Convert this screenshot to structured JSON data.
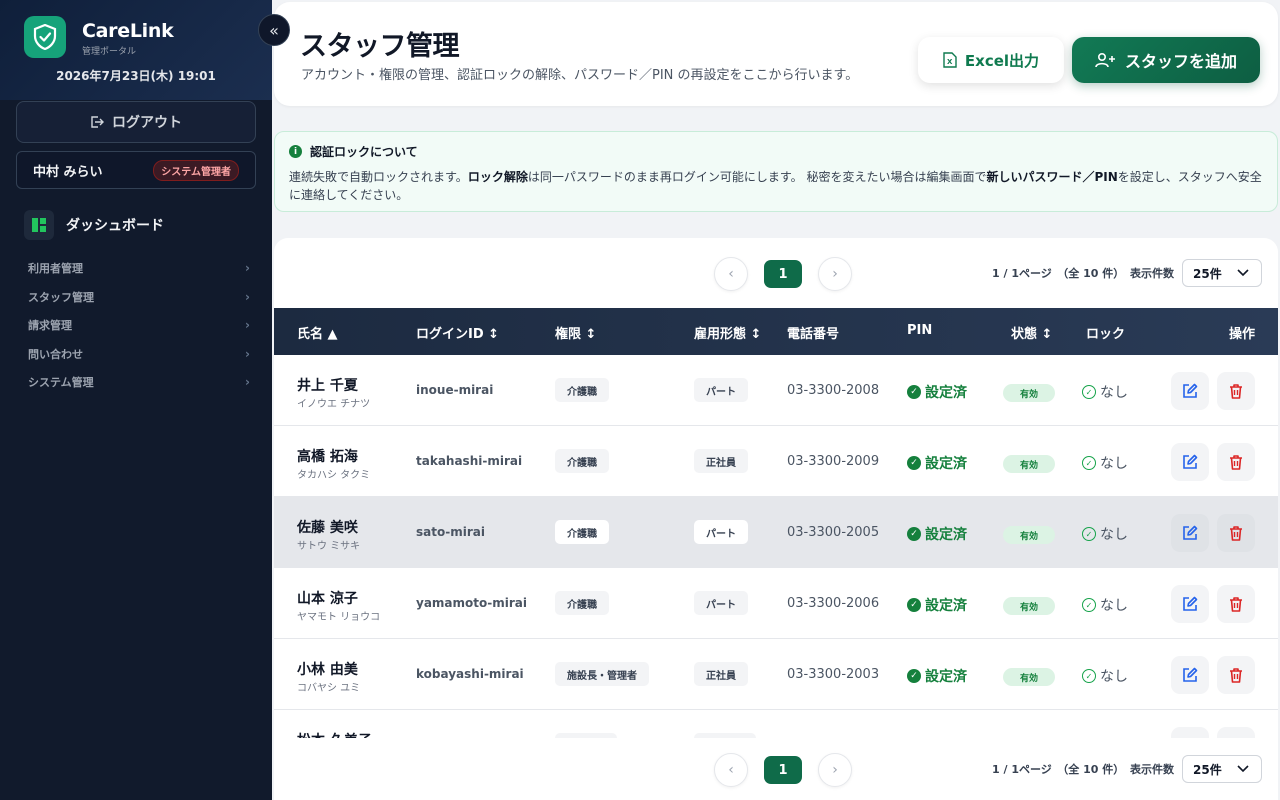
{
  "app": {
    "brand": "CareLink",
    "brand_sub": "管理ポータル",
    "datetime": "2026年7月23日(木) 19:01"
  },
  "sidebar": {
    "logout_label": "ログアウト",
    "user_name": "中村 みらい",
    "user_role": "システム管理者",
    "dashboard_label": "ダッシュボード",
    "nav_items": [
      {
        "label": "利用者管理"
      },
      {
        "label": "スタッフ管理"
      },
      {
        "label": "請求管理"
      },
      {
        "label": "問い合わせ"
      },
      {
        "label": "システム管理"
      }
    ]
  },
  "header": {
    "title": "スタッフ管理",
    "subtitle": "アカウント・権限の管理、認証ロックの解除、パスワード／PIN の再設定をここから行います。",
    "excel_label": "Excel出力",
    "add_label": "スタッフを追加"
  },
  "info": {
    "title": "認証ロックについて",
    "text1": "連続失敗で自動ロックされます。",
    "bold1": "ロック解除",
    "text2": "は同一パスワードのまま再ログイン可能にします。 秘密を変えたい場合は編集画面で",
    "bold2": "新しいパスワード／PIN",
    "text3": "を設定し、スタッフへ安全に連絡してください。"
  },
  "pager": {
    "current_page": "1",
    "page_info": "1 / 1ページ　（全 10 件）",
    "per_page_label": "表示件数",
    "per_page_value": "25件"
  },
  "table": {
    "headers": {
      "name": "氏名 ▲",
      "login_id": "ログインID ↕",
      "role": "権限 ↕",
      "employment": "雇用形態 ↕",
      "phone": "電話番号",
      "pin": "PIN",
      "status": "状態 ↕",
      "lock": "ロック",
      "actions": "操作"
    },
    "rows": [
      {
        "name": "井上 千夏",
        "kana": "イノウエ チナツ",
        "login_id": "inoue-mirai",
        "role": "介護職",
        "employment": "パート",
        "phone": "03-3300-2008",
        "pin": "設定済",
        "status": "有効",
        "lock": "なし"
      },
      {
        "name": "高橋 拓海",
        "kana": "タカハシ タクミ",
        "login_id": "takahashi-mirai",
        "role": "介護職",
        "employment": "正社員",
        "phone": "03-3300-2009",
        "pin": "設定済",
        "status": "有効",
        "lock": "なし"
      },
      {
        "name": "佐藤 美咲",
        "kana": "サトウ ミサキ",
        "login_id": "sato-mirai",
        "role": "介護職",
        "employment": "パート",
        "phone": "03-3300-2005",
        "pin": "設定済",
        "status": "有効",
        "lock": "なし"
      },
      {
        "name": "山本 涼子",
        "kana": "ヤマモト リョウコ",
        "login_id": "yamamoto-mirai",
        "role": "介護職",
        "employment": "パート",
        "phone": "03-3300-2006",
        "pin": "設定済",
        "status": "有効",
        "lock": "なし"
      },
      {
        "name": "小林 由美",
        "kana": "コバヤシ ユミ",
        "login_id": "kobayashi-mirai",
        "role": "施設長・管理者",
        "employment": "正社員",
        "phone": "03-3300-2003",
        "pin": "設定済",
        "status": "有効",
        "lock": "なし"
      },
      {
        "name": "松本 久美子",
        "kana": "",
        "login_id": "",
        "role": "",
        "employment": "",
        "phone": "",
        "pin": "",
        "status": "",
        "lock": ""
      }
    ]
  },
  "colors": {
    "sidebar_bg": "#111a2c",
    "accent_green": "#0f6b49",
    "danger_red": "#dc2626",
    "edit_blue": "#2563eb"
  }
}
